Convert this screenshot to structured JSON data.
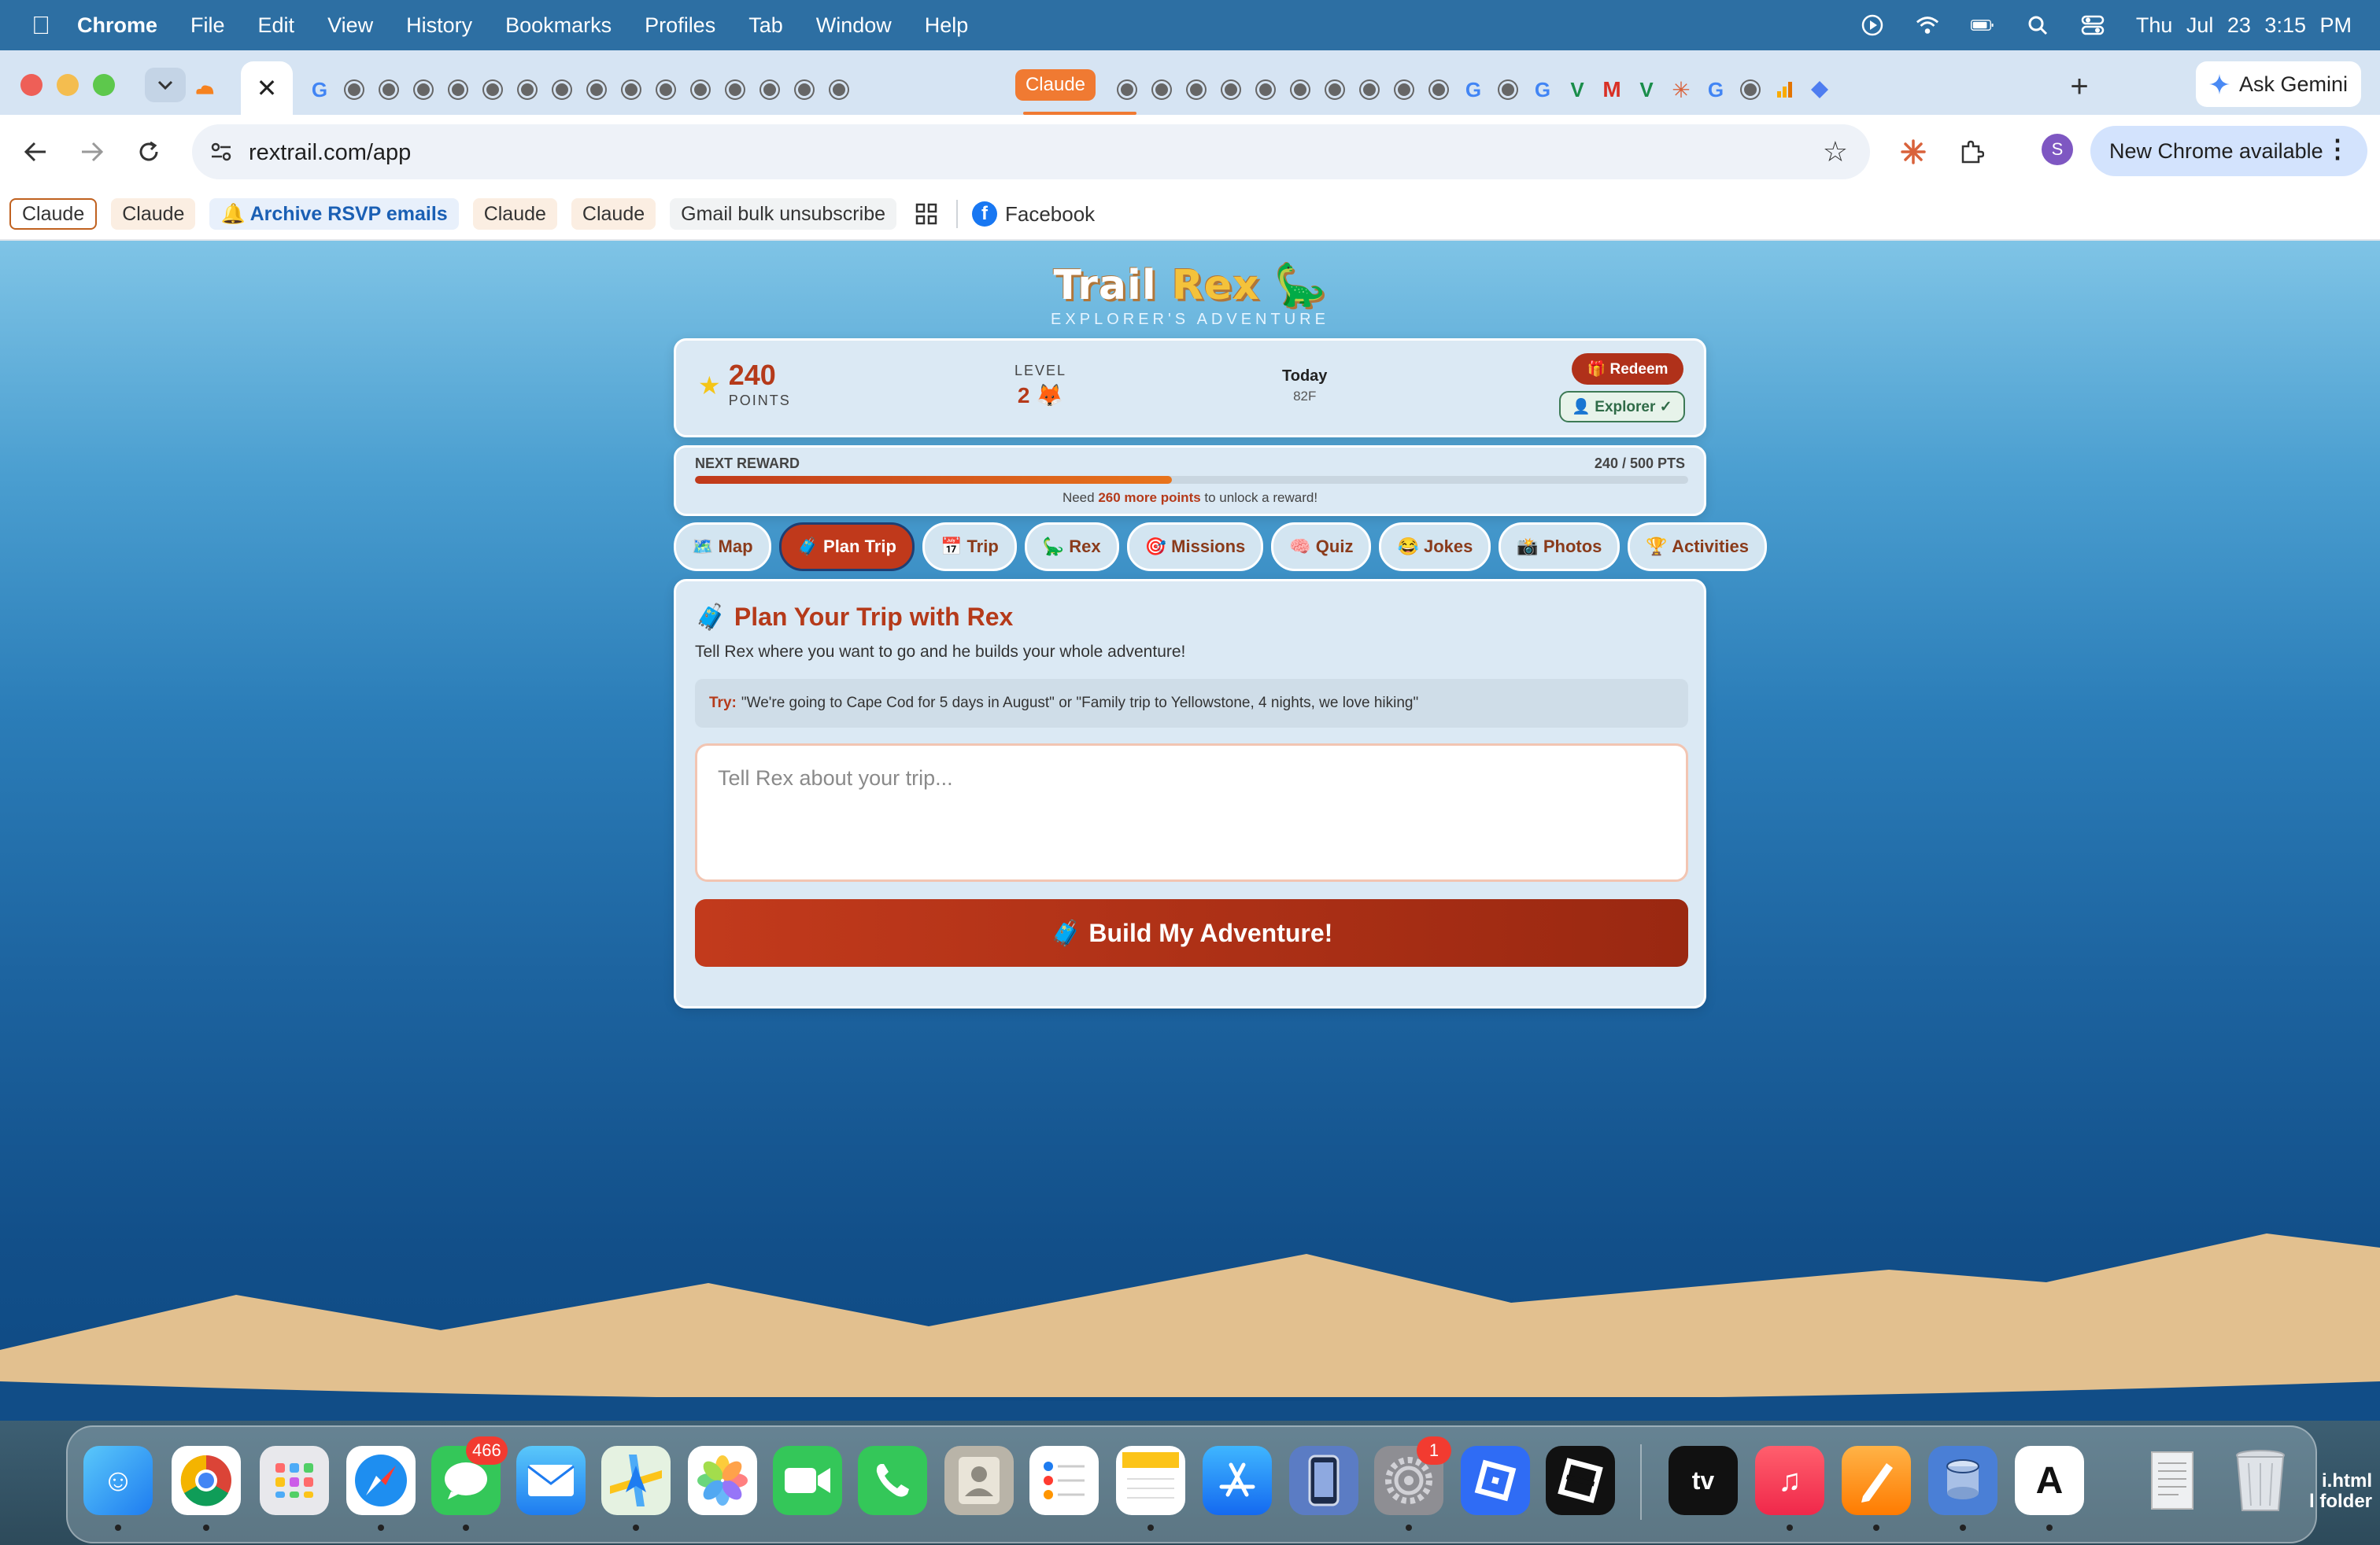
{
  "menubar": {
    "app": "Chrome",
    "items": [
      "File",
      "Edit",
      "View",
      "History",
      "Bookmarks",
      "Profiles",
      "Tab",
      "Window",
      "Help"
    ],
    "clock": "Thu Jul 23  3:15 PM"
  },
  "tabs": {
    "highlighted_tab": "Claude",
    "ask_gemini": "Ask Gemini"
  },
  "toolbar": {
    "url": "rextrail.com/app",
    "avatar_letter": "S",
    "update_label": "New Chrome available"
  },
  "bookmarks": {
    "items": [
      "Claude",
      "Claude",
      "🔔 Archive RSVP emails",
      "Claude",
      "Claude",
      "Gmail bulk unsubscribe"
    ],
    "facebook": "Facebook"
  },
  "app": {
    "title_part1": "Trail ",
    "title_part2": "Rex",
    "title_emoji": "🦕",
    "subtitle": "EXPLORER'S ADVENTURE",
    "stats": {
      "points_value": "240",
      "points_label": "POINTS",
      "level_label": "LEVEL",
      "level_value": "2 🦊",
      "weather_label": "Today",
      "weather_value": "82F",
      "redeem_label": "🎁 Redeem",
      "explorer_label": "👤 Explorer ✓"
    },
    "reward": {
      "label": "NEXT REWARD",
      "progress_text": "240 / 500 PTS",
      "progress_fraction": 0.48,
      "need_prefix": "Need ",
      "need_amount": "260 more points",
      "need_suffix": " to unlock a reward!"
    },
    "nav_tabs": [
      "🗺️ Map",
      "🧳 Plan Trip",
      "📅 Trip",
      "🦕 Rex",
      "🎯 Missions",
      "🧠 Quiz",
      "😂 Jokes",
      "📸 Photos",
      "🏆 Activities"
    ],
    "active_tab": "🧳 Plan Trip",
    "plan": {
      "title_icon": "🧳",
      "title": "Plan Your Trip with Rex",
      "description": "Tell Rex where you want to go and he builds your whole adventure!",
      "tip_label": "Try:",
      "tip_text": "\"We're going to Cape Cod for 5 days in August\" or \"Family trip to Yellowstone, 4 nights, we love hiking\"",
      "input_placeholder": "Tell Rex about your trip...",
      "build_button": "🧳 Build My Adventure!"
    }
  },
  "dock": {
    "messages_badge": "466",
    "settings_badge": "1",
    "apps": [
      "Finder",
      "Chrome",
      "Launchpad",
      "Safari",
      "Messages",
      "Mail",
      "Maps",
      "Photos",
      "FaceTime",
      "Phone",
      "Contacts",
      "Reminders",
      "Notes",
      "App Store",
      "Simulator",
      "System Settings",
      "Roblox",
      "Roblox Studio",
      "TV",
      "Music",
      "Pages",
      "Disk Utility",
      "Dictionary",
      "Document",
      "Trash"
    ],
    "desktop_label_line1": "i.html",
    "desktop_label_line2": "l folder"
  },
  "colors": {
    "accent": "#b53a1a",
    "active_tab": "#c0391b",
    "sand": "#e2c08f",
    "claude_tab": "#f07a32"
  }
}
